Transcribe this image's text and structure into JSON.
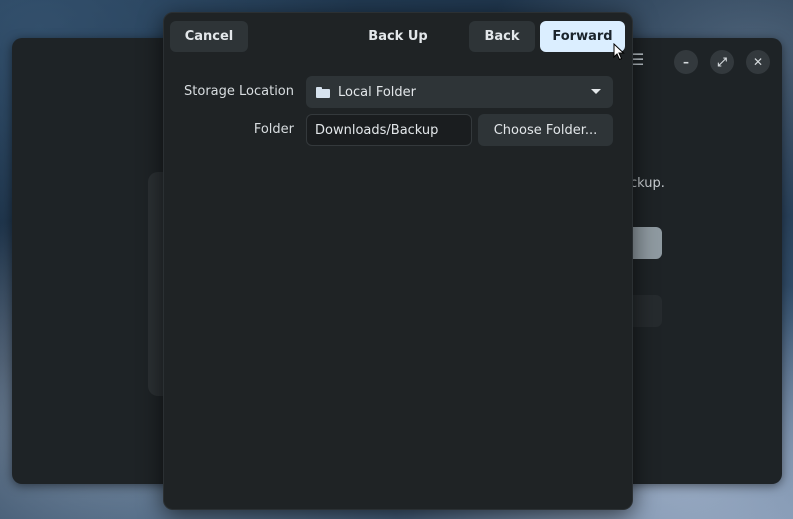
{
  "dialog": {
    "title": "Back Up",
    "cancel_label": "Cancel",
    "back_label": "Back",
    "forward_label": "Forward",
    "storage_location_label": "Storage Location",
    "storage_location_value": "Local Folder",
    "folder_label": "Folder",
    "folder_value": "Downloads/Backup",
    "choose_folder_label": "Choose Folder..."
  },
  "background_window": {
    "partial_text": "ckup."
  },
  "colors": {
    "accent_button": "#dbeeff",
    "dialog_bg": "#1f2325"
  },
  "icons": [
    "folder-icon",
    "dropdown-caret-icon",
    "menu-icon",
    "minimize-icon",
    "maximize-icon",
    "close-icon",
    "mouse-pointer-icon"
  ]
}
